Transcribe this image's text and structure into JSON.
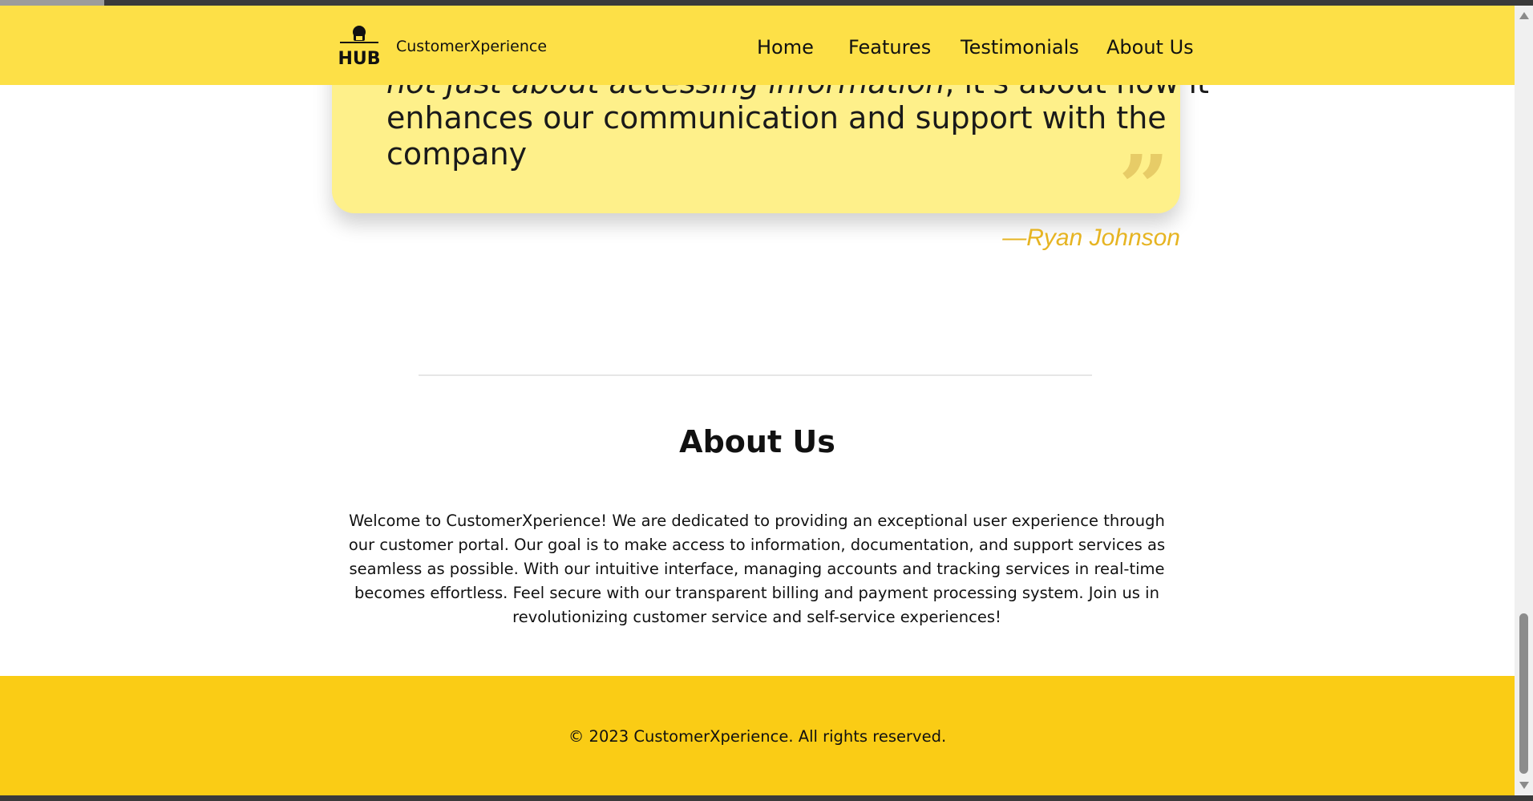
{
  "navbar": {
    "brand": "CustomerXperience",
    "logo_text": "HUB",
    "links": [
      "Home",
      "Features",
      "Testimonials",
      "About Us"
    ]
  },
  "testimonial": {
    "line_partial_a": "not just about accessing information",
    "line_partial_b": ", it's about how it",
    "line2": "enhances our communication and support with the",
    "line3": "company",
    "author": "—Ryan Johnson"
  },
  "about": {
    "title": "About Us",
    "body": "Welcome to CustomerXperience! We are dedicated to providing an exceptional user experience through our customer portal. Our goal is to make access to information, documentation, and support services as seamless as possible. With our intuitive interface, managing accounts and tracking services in real-time becomes effortless. Feel secure with our transparent billing and payment processing system. Join us in revolutionizing customer service and self-service experiences!"
  },
  "footer": {
    "copyright": "© 2023 CustomerXperience. All rights reserved."
  },
  "colors": {
    "navbar": "#fde047",
    "card": "#fef08a",
    "footer": "#facc15",
    "author": "#e6b422"
  }
}
